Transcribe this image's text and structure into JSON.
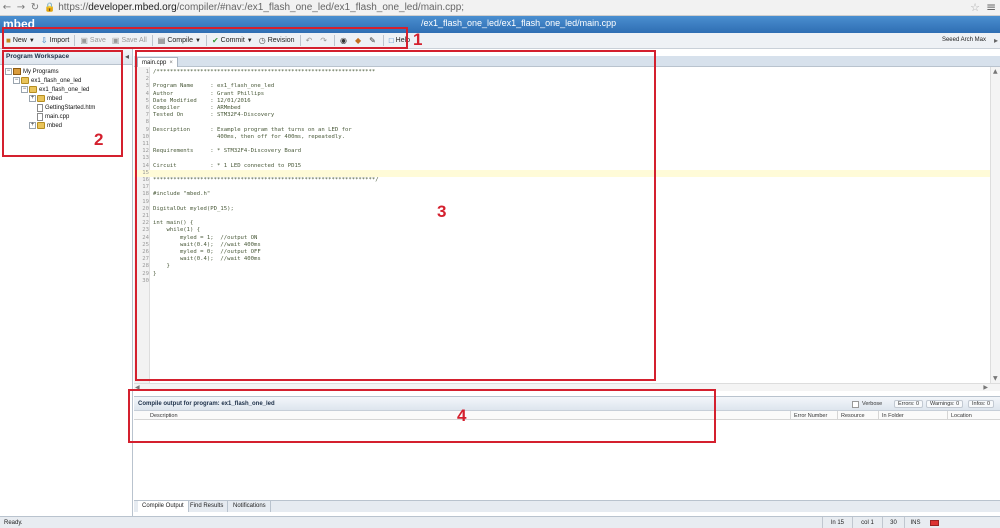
{
  "browser": {
    "url_protocol": "https://",
    "url_domain": "developer.mbed.org",
    "url_path": "/compiler/#nav:/ex1_flash_one_led/ex1_flash_one_led/main.cpp;"
  },
  "app": {
    "logo": "mbed",
    "path": "/ex1_flash_one_led/ex1_flash_one_led/main.cpp",
    "user": "Seeed Arch Max"
  },
  "toolbar": {
    "new": "New",
    "import": "Import",
    "save": "Save",
    "save_all": "Save All",
    "compile": "Compile",
    "commit": "Commit",
    "revision": "Revision",
    "help": "Help"
  },
  "workspace": {
    "title": "Program Workspace",
    "tree": [
      {
        "label": "My Programs"
      },
      {
        "label": "ex1_flash_one_led"
      },
      {
        "label": "ex1_flash_one_led"
      },
      {
        "label": "mbed"
      },
      {
        "label": "GettingStarted.htm"
      },
      {
        "label": "main.cpp"
      },
      {
        "label": "mbed"
      }
    ]
  },
  "editor": {
    "tab": "main.cpp",
    "current_line": 15,
    "lines": [
      "/*****************************************************************",
      "",
      "Program Name     : ex1_flash_one_led",
      "Author           : Grant Phillips",
      "Date Modified    : 12/01/2016",
      "Compiler         : ARMmbed",
      "Tested On        : STM32F4-Discovery",
      "",
      "Description      : Example program that turns on an LED for",
      "                   400ms, then off for 400ms, repeatedly.",
      "",
      "Requirements     : * STM32F4-Discovery Board",
      "",
      "Circuit          : * 1 LED connected to PD15",
      "",
      "******************************************************************/",
      "",
      "#include \"mbed.h\"",
      "",
      "DigitalOut myled(PD_15);",
      "",
      "int main() {",
      "    while(1) {",
      "        myled = 1;  //output ON",
      "        wait(0.4);  //wait 400ms",
      "        myled = 0;  //output OFF",
      "        wait(0.4);  //wait 400ms",
      "    }",
      "}",
      ""
    ]
  },
  "compile": {
    "title": "Compile output for program: ex1_flash_one_led",
    "verbose": "Verbose",
    "errors": "Errors: 0",
    "warnings": "Warnings: 0",
    "infos": "Infos: 0",
    "columns": {
      "description": "Description",
      "error_number": "Error Number",
      "resource": "Resource",
      "in_folder": "In Folder",
      "location": "Location"
    }
  },
  "bottom_tabs": {
    "compile_output": "Compile Output",
    "find_results": "Find Results",
    "notifications": "Notifications"
  },
  "status": {
    "text": "Ready.",
    "line": "ln 15",
    "col": "col 1",
    "num": "30",
    "mode": "INS"
  },
  "callouts": [
    "1",
    "2",
    "3",
    "4"
  ],
  "colors": {
    "header_blue": "#2f6eb3",
    "callout_red": "#d4202e"
  }
}
